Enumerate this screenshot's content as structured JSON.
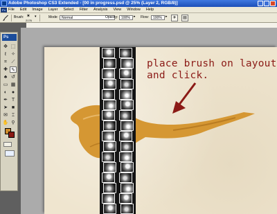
{
  "window": {
    "title": "Adobe Photoshop CS3 Extended - [00 in progress.psd @ 25% (Layer 2, RGB/8)]"
  },
  "menu": {
    "app_badge": "Ps",
    "items": [
      "File",
      "Edit",
      "Image",
      "Layer",
      "Select",
      "Filter",
      "Analysis",
      "View",
      "Window",
      "Help"
    ]
  },
  "options_bar": {
    "brush_label": "Brush:",
    "brush_size": "2176",
    "mode_label": "Mode:",
    "mode_value": "Normal",
    "opacity_label": "Opacity:",
    "opacity_value": "100%",
    "flow_label": "Flow:",
    "flow_value": "100%"
  },
  "toolbox": {
    "logo": "Ps",
    "icons": [
      "move-icon",
      "marquee-icon",
      "lasso-icon",
      "magic-wand-icon",
      "crop-icon",
      "slice-icon",
      "healing-icon",
      "brush-icon",
      "stamp-icon",
      "history-brush-icon",
      "eraser-icon",
      "gradient-icon",
      "blur-icon",
      "dodge-icon",
      "pen-icon",
      "type-icon",
      "path-select-icon",
      "shape-icon",
      "notes-icon",
      "eyedropper-icon",
      "hand-icon",
      "zoom-icon"
    ],
    "foreground_color": "#cc8a2c",
    "background_color": "#8a1a14"
  },
  "canvas": {
    "annotation": "place brush on layout\nand click.",
    "stroke_color": "#d59733",
    "annotation_color": "#8b1a16",
    "photo_rows": 16
  }
}
